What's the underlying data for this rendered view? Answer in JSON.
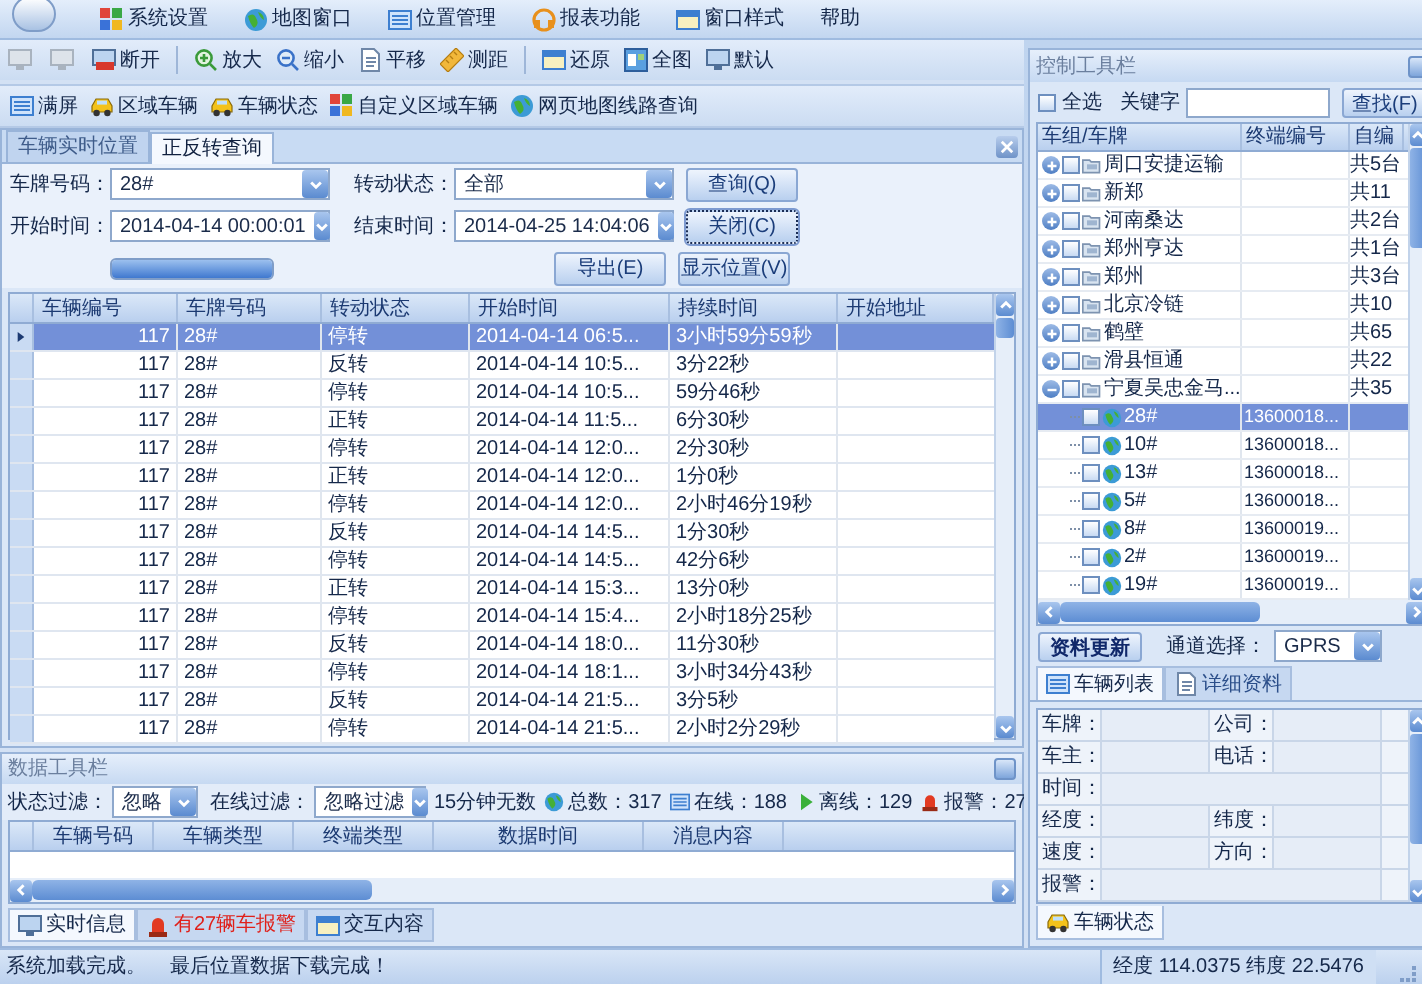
{
  "app_menu": {
    "items": [
      {
        "label": "系统设置"
      },
      {
        "label": "地图窗口"
      },
      {
        "label": "位置管理"
      },
      {
        "label": "报表功能"
      },
      {
        "label": "窗口样式"
      },
      {
        "label": "帮助"
      }
    ]
  },
  "map_toolbar": {
    "items": [
      {
        "label": "断开"
      },
      {
        "label": "放大"
      },
      {
        "label": "缩小"
      },
      {
        "label": "平移"
      },
      {
        "label": "测距"
      },
      {
        "label": "还原"
      },
      {
        "label": "全图"
      },
      {
        "label": "默认"
      }
    ]
  },
  "vehicle_toolbar": {
    "items": [
      {
        "label": "满屏"
      },
      {
        "label": "区域车辆"
      },
      {
        "label": "车辆状态"
      },
      {
        "label": "自定义区域车辆"
      },
      {
        "label": "网页地图线路查询"
      }
    ]
  },
  "query_panel": {
    "tabs": [
      {
        "label": "车辆实时位置",
        "selected": false
      },
      {
        "label": "正反转查询",
        "selected": true
      }
    ],
    "plate": {
      "label": "车牌号码：",
      "value": "28#"
    },
    "rotation_state": {
      "label": "转动状态：",
      "value": "全部"
    },
    "start_time": {
      "label": "开始时间：",
      "value": "2014-04-14 00:00:01"
    },
    "end_time": {
      "label": "结束时间：",
      "value": "2014-04-25 14:04:06"
    },
    "progress": {
      "level": 1
    },
    "buttons": [
      {
        "label": "查询(Q)",
        "focused": false
      },
      {
        "label": "关闭(C)",
        "focused": true
      },
      {
        "label": "导出(E)",
        "focused": false
      },
      {
        "label": "显示位置(V)",
        "focused": false
      }
    ]
  },
  "grid": {
    "columns": [
      "车辆编号",
      "车牌号码",
      "转动状态",
      "开始时间",
      "持续时间",
      "开始地址"
    ],
    "rows": [
      {
        "cells": [
          "117",
          "28#",
          "停转",
          "2014-04-14 06:5...",
          "3小时59分59秒"
        ],
        "selected": true
      },
      {
        "cells": [
          "117",
          "28#",
          "反转",
          "2014-04-14 10:5...",
          "3分22秒"
        ],
        "selected": false
      },
      {
        "cells": [
          "117",
          "28#",
          "停转",
          "2014-04-14 10:5...",
          "59分46秒"
        ],
        "selected": false
      },
      {
        "cells": [
          "117",
          "28#",
          "正转",
          "2014-04-14 11:5...",
          "6分30秒"
        ],
        "selected": false
      },
      {
        "cells": [
          "117",
          "28#",
          "停转",
          "2014-04-14 12:0...",
          "2分30秒"
        ],
        "selected": false
      },
      {
        "cells": [
          "117",
          "28#",
          "正转",
          "2014-04-14 12:0...",
          "1分0秒"
        ],
        "selected": false
      },
      {
        "cells": [
          "117",
          "28#",
          "停转",
          "2014-04-14 12:0...",
          "2小时46分19秒"
        ],
        "selected": false
      },
      {
        "cells": [
          "117",
          "28#",
          "反转",
          "2014-04-14 14:5...",
          "1分30秒"
        ],
        "selected": false
      },
      {
        "cells": [
          "117",
          "28#",
          "停转",
          "2014-04-14 14:5...",
          "42分6秒"
        ],
        "selected": false
      },
      {
        "cells": [
          "117",
          "28#",
          "正转",
          "2014-04-14 15:3...",
          "13分0秒"
        ],
        "selected": false
      },
      {
        "cells": [
          "117",
          "28#",
          "停转",
          "2014-04-14 15:4...",
          "2小时18分25秒"
        ],
        "selected": false
      },
      {
        "cells": [
          "117",
          "28#",
          "反转",
          "2014-04-14 18:0...",
          "11分30秒"
        ],
        "selected": false
      },
      {
        "cells": [
          "117",
          "28#",
          "停转",
          "2014-04-14 18:1...",
          "3小时34分43秒"
        ],
        "selected": false
      },
      {
        "cells": [
          "117",
          "28#",
          "反转",
          "2014-04-14 21:5...",
          "3分5秒"
        ],
        "selected": false
      },
      {
        "cells": [
          "117",
          "28#",
          "停转",
          "2014-04-14 21:5...",
          "2小时2分29秒"
        ],
        "selected": false
      }
    ]
  },
  "data_panel": {
    "title": "数据工具栏",
    "status_filter": {
      "label": "状态过滤：",
      "value": "忽略"
    },
    "online_filter": {
      "label": "在线过滤：",
      "value": "忽略过滤"
    },
    "no_data_note": "15分钟无数",
    "stats": [
      {
        "label": "总数：317"
      },
      {
        "label": "在线：188"
      },
      {
        "label": "离线：129"
      },
      {
        "label": "报警：27"
      }
    ],
    "columns": [
      "车辆号码",
      "车辆类型",
      "终端类型",
      "数据时间",
      "消息内容"
    ],
    "tabs": [
      {
        "label": "实时信息",
        "selected": true,
        "alert": false
      },
      {
        "label": "有27辆车报警",
        "selected": false,
        "alert": true
      },
      {
        "label": "交互内容",
        "selected": false,
        "alert": false
      }
    ]
  },
  "control_panel": {
    "title": "控制工具栏",
    "select_all": {
      "label": "全选",
      "checked": false
    },
    "keyword_label": "关键字",
    "find_button": "查找(F)",
    "tree": {
      "columns": [
        "车组/车牌",
        "终端编号",
        "自编"
      ],
      "groups": [
        {
          "name": "周口安捷运输",
          "count": "共5台",
          "expanded": false,
          "checked": false
        },
        {
          "name": "新郑",
          "count": "共11",
          "expanded": false,
          "checked": false
        },
        {
          "name": "河南桑达",
          "count": "共2台",
          "expanded": false,
          "checked": false
        },
        {
          "name": "郑州亨达",
          "count": "共1台",
          "expanded": false,
          "checked": false
        },
        {
          "name": "郑州",
          "count": "共3台",
          "expanded": false,
          "checked": false
        },
        {
          "name": "北京冷链",
          "count": "共10",
          "expanded": false,
          "checked": false
        },
        {
          "name": "鹤壁",
          "count": "共65",
          "expanded": false,
          "checked": false
        },
        {
          "name": "滑县恒通",
          "count": "共22",
          "expanded": false,
          "checked": false
        },
        {
          "name": "宁夏吴忠金马...",
          "count": "共35",
          "expanded": true,
          "checked": false,
          "children": [
            {
              "name": "28#",
              "terminal": "13600018...",
              "checked": false,
              "selected": true
            },
            {
              "name": "10#",
              "terminal": "13600018...",
              "checked": false,
              "selected": false
            },
            {
              "name": "13#",
              "terminal": "13600018...",
              "checked": false,
              "selected": false
            },
            {
              "name": "5#",
              "terminal": "13600018...",
              "checked": false,
              "selected": false
            },
            {
              "name": "8#",
              "terminal": "13600019...",
              "checked": false,
              "selected": false
            },
            {
              "name": "2#",
              "terminal": "13600019...",
              "checked": false,
              "selected": false
            },
            {
              "name": "19#",
              "terminal": "13600019...",
              "checked": false,
              "selected": false
            }
          ]
        }
      ]
    },
    "refresh_button": "资料更新",
    "channel": {
      "label": "通道选择：",
      "value": "GPRS"
    },
    "tabs": [
      {
        "label": "车辆列表",
        "selected": true
      },
      {
        "label": "详细资料",
        "selected": false
      }
    ],
    "detail_rows": [
      [
        "车牌：",
        "公司："
      ],
      [
        "车主：",
        "电话："
      ],
      [
        "时间："
      ],
      [
        "经度：",
        "纬度："
      ],
      [
        "速度：",
        "方向："
      ],
      [
        "报警："
      ]
    ],
    "status_tab": "车辆状态"
  },
  "status_bar": {
    "messages": [
      "系统加载完成。",
      "最后位置数据下载完成！"
    ],
    "coordinates": "经度 114.0375 纬度 22.5476"
  }
}
